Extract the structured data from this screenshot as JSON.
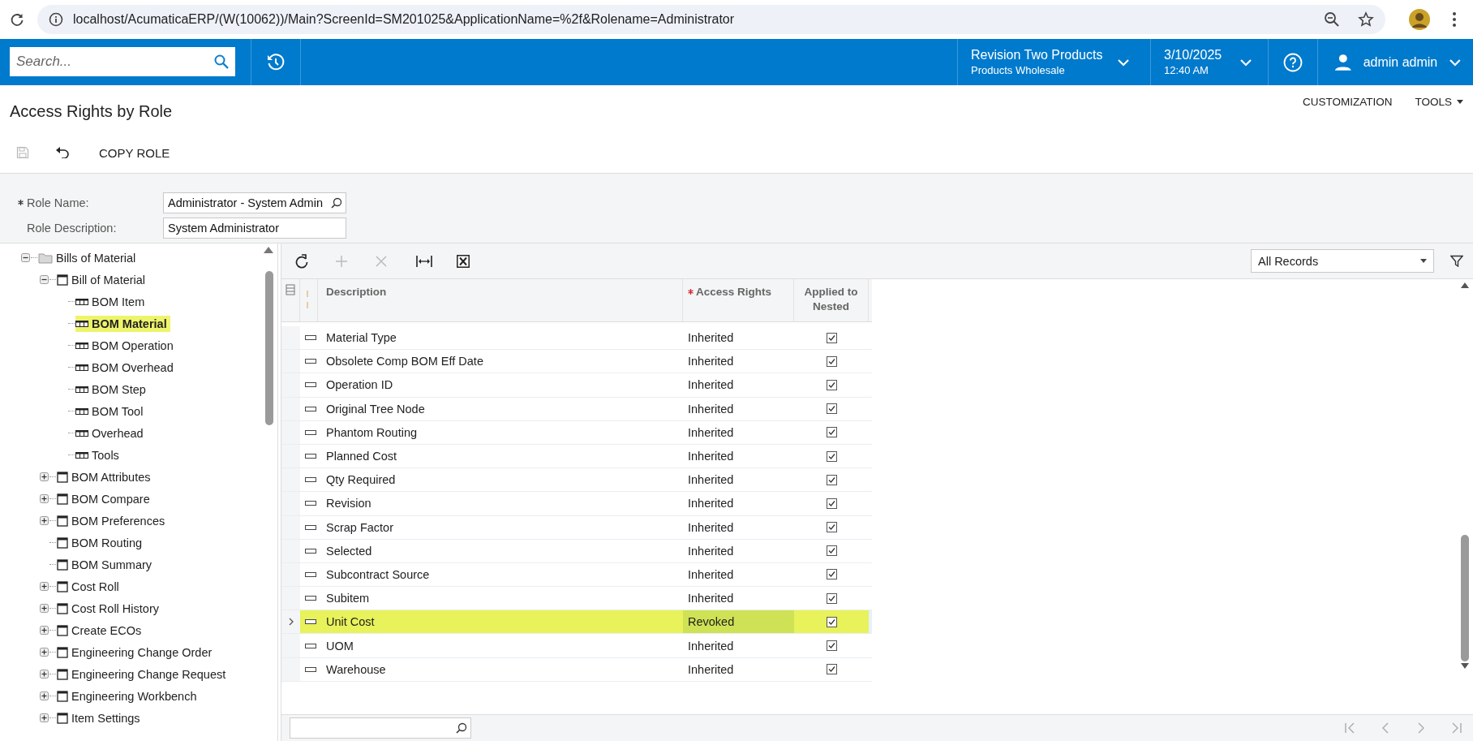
{
  "browser": {
    "url": "localhost/AcumaticaERP/(W(10062))/Main?ScreenId=SM201025&ApplicationName=%2f&Rolename=Administrator"
  },
  "header": {
    "search": {
      "placeholder": "Search..."
    },
    "company": {
      "name": "Revision Two Products",
      "branch": "Products Wholesale"
    },
    "date": {
      "date": "3/10/2025",
      "time": "12:40 AM"
    },
    "user": "admin admin"
  },
  "page": {
    "title": "Access Rights by Role",
    "menu": [
      {
        "label": "CUSTOMIZATION",
        "dropdown": false
      },
      {
        "label": "TOOLS",
        "dropdown": true
      }
    ],
    "toolbar": {
      "save_disabled": true,
      "copy": "COPY ROLE"
    }
  },
  "form": {
    "fields": [
      {
        "label": "Role Name:",
        "required": true,
        "value": "Administrator - System Admin",
        "lookup": true
      },
      {
        "label": "Role Description:",
        "required": false,
        "value": "System Administrator",
        "lookup": false
      }
    ]
  },
  "tree": {
    "items": [
      {
        "label": "Bills of Material",
        "kind": "folder",
        "expanded": true,
        "selected": false,
        "children": [
          {
            "label": "Bill of Material",
            "kind": "screen",
            "expanded": true,
            "selected": false,
            "children": [
              {
                "label": "BOM Item",
                "kind": "table",
                "selected": false
              },
              {
                "label": "BOM Material",
                "kind": "table",
                "selected": true
              },
              {
                "label": "BOM Operation",
                "kind": "table",
                "selected": false
              },
              {
                "label": "BOM Overhead",
                "kind": "table",
                "selected": false
              },
              {
                "label": "BOM Step",
                "kind": "table",
                "selected": false
              },
              {
                "label": "BOM Tool",
                "kind": "table",
                "selected": false
              },
              {
                "label": "Overhead",
                "kind": "table",
                "selected": false
              },
              {
                "label": "Tools",
                "kind": "table",
                "selected": false
              }
            ]
          },
          {
            "label": "BOM Attributes",
            "kind": "screen",
            "expanded": false,
            "selected": false
          },
          {
            "label": "BOM Compare",
            "kind": "screen",
            "expanded": false,
            "selected": false
          },
          {
            "label": "BOM Preferences",
            "kind": "screen",
            "expanded": false,
            "selected": false
          },
          {
            "label": "BOM Routing",
            "kind": "screen",
            "selected": false
          },
          {
            "label": "BOM Summary",
            "kind": "screen",
            "selected": false
          },
          {
            "label": "Cost Roll",
            "kind": "screen",
            "expanded": false,
            "selected": false
          },
          {
            "label": "Cost Roll History",
            "kind": "screen",
            "expanded": false,
            "selected": false
          },
          {
            "label": "Create ECOs",
            "kind": "screen",
            "expanded": false,
            "selected": false
          },
          {
            "label": "Engineering Change Order",
            "kind": "screen",
            "expanded": false,
            "selected": false
          },
          {
            "label": "Engineering Change Request",
            "kind": "screen",
            "expanded": false,
            "selected": false
          },
          {
            "label": "Engineering Workbench",
            "kind": "screen",
            "expanded": false,
            "selected": false
          },
          {
            "label": "Item Settings",
            "kind": "screen",
            "expanded": false,
            "selected": false
          }
        ]
      }
    ]
  },
  "grid": {
    "filter": "All Records",
    "columns": [
      {
        "label": "Description",
        "required": false
      },
      {
        "label": "Access Rights",
        "required": true
      },
      {
        "label": "Applied to Nested",
        "required": false
      }
    ],
    "rows": [
      {
        "description": "Material Type",
        "access": "Inherited",
        "applied": true,
        "selected": false
      },
      {
        "description": "Obsolete Comp BOM Eff Date",
        "access": "Inherited",
        "applied": true,
        "selected": false
      },
      {
        "description": "Operation ID",
        "access": "Inherited",
        "applied": true,
        "selected": false
      },
      {
        "description": "Original Tree Node",
        "access": "Inherited",
        "applied": true,
        "selected": false
      },
      {
        "description": "Phantom Routing",
        "access": "Inherited",
        "applied": true,
        "selected": false
      },
      {
        "description": "Planned Cost",
        "access": "Inherited",
        "applied": true,
        "selected": false
      },
      {
        "description": "Qty Required",
        "access": "Inherited",
        "applied": true,
        "selected": false
      },
      {
        "description": "Revision",
        "access": "Inherited",
        "applied": true,
        "selected": false
      },
      {
        "description": "Scrap Factor",
        "access": "Inherited",
        "applied": true,
        "selected": false
      },
      {
        "description": "Selected",
        "access": "Inherited",
        "applied": true,
        "selected": false
      },
      {
        "description": "Subcontract Source",
        "access": "Inherited",
        "applied": true,
        "selected": false
      },
      {
        "description": "Subitem",
        "access": "Inherited",
        "applied": true,
        "selected": false
      },
      {
        "description": "Unit Cost",
        "access": "Revoked",
        "applied": true,
        "selected": true
      },
      {
        "description": "UOM",
        "access": "Inherited",
        "applied": true,
        "selected": false
      },
      {
        "description": "Warehouse",
        "access": "Inherited",
        "applied": true,
        "selected": false
      }
    ]
  }
}
